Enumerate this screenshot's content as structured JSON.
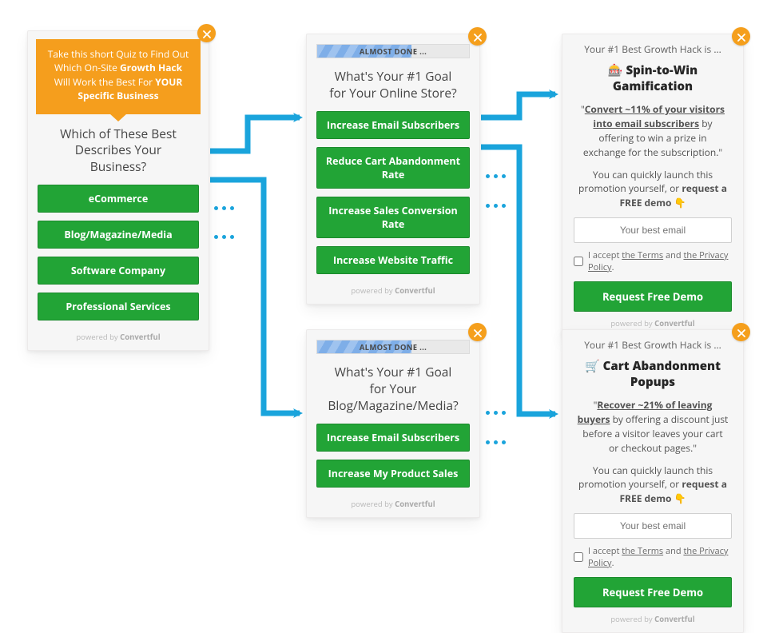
{
  "colors": {
    "accent_orange": "#f59e1d",
    "button_green": "#22a436",
    "arrow_blue": "#1aa4dc"
  },
  "powered": {
    "prefix": "powered by ",
    "brand": "Convertful"
  },
  "card1": {
    "banner_html": "Take this short Quiz to Find Out Which On-Site <b>Growth Hack</b> Will Work the Best For <b>YOUR Specific Business</b>",
    "question": "Which of These Best Describes Your Business?",
    "options": [
      "eCommerce",
      "Blog/Magazine/Media",
      "Software Company",
      "Professional Services"
    ]
  },
  "card2": {
    "progress_label": "ALMOST DONE ...",
    "question": "What's Your #1 Goal for Your Online Store?",
    "options": [
      "Increase Email Subscribers",
      "Reduce Cart Abandonment Rate",
      "Increase Sales Conversion Rate",
      "Increase Website Traffic"
    ]
  },
  "card3": {
    "progress_label": "ALMOST DONE ...",
    "question": "What's Your #1 Goal for Your Blog/Magazine/Media?",
    "options": [
      "Increase Email Subscribers",
      "Increase My Product Sales"
    ]
  },
  "result_common": {
    "pre": "Your #1 Best Growth Hack is ...",
    "launch_html": "You can quickly launch this promotion yourself, or <b>request a FREE demo</b> <span class='pd'>👇</span>",
    "email_placeholder": "Your best email",
    "accept_prefix": "I accept ",
    "terms": "the Terms",
    "and": " and ",
    "privacy": "the Privacy Policy",
    "dot": ".",
    "cta": "Request Free Demo"
  },
  "card4": {
    "emoji": "🎰",
    "title": "Spin-to-Win Gamification",
    "body_html": "\"<b><u>Convert ~11% of your visitors into email subscribers</u></b> by offering to win a prize in exchange for the subscription.\""
  },
  "card5": {
    "emoji": "🛒",
    "title": "Cart Abandonment Popups",
    "body_html": "\"<b><u>Recover ~21% of leaving buyers</u></b> by offering a discount just before a visitor leaves your cart or checkout pages.\""
  }
}
